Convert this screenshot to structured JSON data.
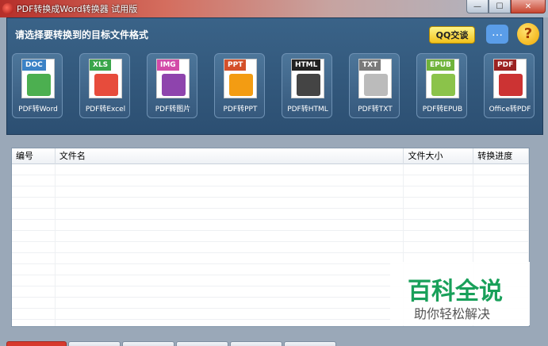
{
  "window": {
    "title": "PDF转换成Word转换器 试用版",
    "min_glyph": "—",
    "max_glyph": "☐",
    "close_glyph": "✕"
  },
  "header": {
    "prompt": "请选择要转换到的目标文件格式",
    "qq_label": "QQ交谈",
    "chat_glyph": "…",
    "help_glyph": "?"
  },
  "formats": [
    {
      "tag": "DOC",
      "label": "PDF转Word",
      "tag_color": "#3b82c6",
      "art": "#4caf50"
    },
    {
      "tag": "XLS",
      "label": "PDF转Excel",
      "tag_color": "#3aa54a",
      "art": "#e74c3c"
    },
    {
      "tag": "IMG",
      "label": "PDF转图片",
      "tag_color": "#d24aa8",
      "art": "#8e44ad"
    },
    {
      "tag": "PPT",
      "label": "PDF转PPT",
      "tag_color": "#d4502a",
      "art": "#f39c12"
    },
    {
      "tag": "HTML",
      "label": "PDF转HTML",
      "tag_color": "#222222",
      "art": "#444444"
    },
    {
      "tag": "TXT",
      "label": "PDF转TXT",
      "tag_color": "#7a7a7a",
      "art": "#bbbbbb"
    },
    {
      "tag": "EPUB",
      "label": "PDF转EPUB",
      "tag_color": "#6fb33b",
      "art": "#8bc34a"
    },
    {
      "tag": "PDF",
      "label": "Office转PDF",
      "tag_color": "#9b2222",
      "art": "#cc3333"
    }
  ],
  "table": {
    "headers": [
      "编号",
      "文件名",
      "文件大小",
      "转换进度"
    ]
  },
  "watermark": {
    "main": "百科全说",
    "sub": "助你轻松解决"
  }
}
